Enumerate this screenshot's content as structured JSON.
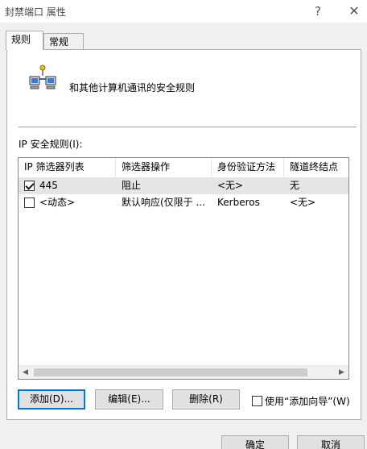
{
  "window": {
    "title": "封禁端口 属性",
    "help_glyph": "?",
    "close_glyph": "✕"
  },
  "tabs": [
    {
      "label": "规则",
      "active": true
    },
    {
      "label": "常规",
      "active": false
    }
  ],
  "header": {
    "icon": "network-computers-icon",
    "text": "和其他计算机通讯的安全规则"
  },
  "list": {
    "label": "IP 安全规则(I):",
    "columns": [
      "IP 筛选器列表",
      "筛选器操作",
      "身份验证方法",
      "隧道终结点"
    ],
    "rows": [
      {
        "checked": true,
        "selected": true,
        "cells": [
          "445",
          "阻止",
          "<无>",
          "无"
        ]
      },
      {
        "checked": false,
        "selected": false,
        "cells": [
          "<动态>",
          "默认响应(仅限于 ...",
          "Kerberos",
          "<无>"
        ]
      }
    ]
  },
  "buttons": {
    "add": "添加(D)...",
    "edit": "编辑(E)...",
    "delete": "删除(R)",
    "ok": "确定",
    "cancel": "取消"
  },
  "wizard_checkbox": {
    "label": "使用“添加向导”(W)",
    "checked": false
  },
  "colors": {
    "focus_border": "#0078d7",
    "selected_row": "#e5e5e5"
  }
}
